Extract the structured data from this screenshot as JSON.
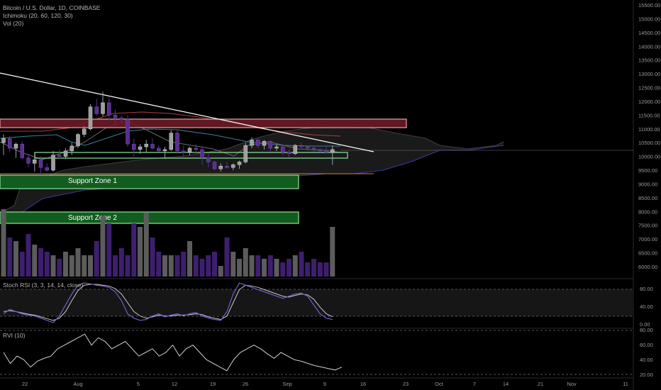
{
  "header": {
    "symbol": "Bitcoin / U.S. Dollar, 1D, COINBASE",
    "ichimoku": "Ichimoku (20, 60, 120, 30)",
    "volume": "Vol (20)"
  },
  "colors": {
    "background": "#000000",
    "up_candle": "#9e9e9e",
    "down_candle": "#5b2d8f",
    "trendline": "#ffffff",
    "resistance_zone": "#b33c4a",
    "support_zone": "#135c1f",
    "support_border": "#8fe59a",
    "tenkan": "#b23a3a",
    "kijun": "#3a7f9a",
    "cloud": "#1a1a1a",
    "rsi_k": "#7b5bd1",
    "rsi_d": "#c8c8c8"
  },
  "annotations": {
    "support_zone_1": "Support Zone 1",
    "support_zone_2": "Support Zone 2"
  },
  "price_axis": [
    "15500.00",
    "15000.00",
    "14500.00",
    "14000.00",
    "13500.00",
    "13000.00",
    "12500.00",
    "12000.00",
    "11500.00",
    "11000.00",
    "10500.00",
    "10000.00",
    "9500.00",
    "9000.00",
    "8500.00",
    "8000.00",
    "7500.00",
    "7000.00",
    "6500.00",
    "6000.00"
  ],
  "time_axis": [
    "22",
    "Aug",
    "5",
    "12",
    "19",
    "26",
    "Sep",
    "9",
    "16",
    "23",
    "Oct",
    "7",
    "14",
    "21",
    "Nov",
    "11"
  ],
  "stoch_rsi": {
    "label": "Stoch RSI (3, 3, 14, 14, close)",
    "ticks": [
      "80.00",
      "40.00",
      "0.00"
    ]
  },
  "rvi": {
    "label": "RVI (10)",
    "ticks": [
      "80.00",
      "60.00",
      "40.00",
      "20.00"
    ]
  },
  "chart_data": {
    "type": "candlestick",
    "price_range": [
      5800,
      15600
    ],
    "candles": [
      {
        "o": 10500,
        "h": 10800,
        "l": 10050,
        "c": 10650
      },
      {
        "o": 10650,
        "h": 10750,
        "l": 10150,
        "c": 10300
      },
      {
        "o": 10300,
        "h": 10500,
        "l": 9950,
        "c": 10450
      },
      {
        "o": 10450,
        "h": 10550,
        "l": 9900,
        "c": 9950
      },
      {
        "o": 9950,
        "h": 10100,
        "l": 9600,
        "c": 9750
      },
      {
        "o": 9750,
        "h": 10000,
        "l": 9450,
        "c": 9880
      },
      {
        "o": 9880,
        "h": 10000,
        "l": 9350,
        "c": 9600
      },
      {
        "o": 9600,
        "h": 9750,
        "l": 9450,
        "c": 9500
      },
      {
        "o": 9500,
        "h": 10200,
        "l": 9450,
        "c": 10050
      },
      {
        "o": 10050,
        "h": 10250,
        "l": 9900,
        "c": 10000
      },
      {
        "o": 10000,
        "h": 10300,
        "l": 9900,
        "c": 10200
      },
      {
        "o": 10200,
        "h": 10500,
        "l": 10050,
        "c": 10380
      },
      {
        "o": 10380,
        "h": 10850,
        "l": 10300,
        "c": 10800
      },
      {
        "o": 10800,
        "h": 11100,
        "l": 10700,
        "c": 11000
      },
      {
        "o": 11000,
        "h": 11900,
        "l": 10950,
        "c": 11800
      },
      {
        "o": 11800,
        "h": 12100,
        "l": 11500,
        "c": 11550
      },
      {
        "o": 11550,
        "h": 12350,
        "l": 11450,
        "c": 11950
      },
      {
        "o": 11950,
        "h": 12150,
        "l": 11300,
        "c": 11500
      },
      {
        "o": 11500,
        "h": 11700,
        "l": 11200,
        "c": 11400
      },
      {
        "o": 11400,
        "h": 11500,
        "l": 11250,
        "c": 11350
      },
      {
        "o": 11350,
        "h": 11500,
        "l": 10350,
        "c": 10450
      },
      {
        "o": 10450,
        "h": 10650,
        "l": 10000,
        "c": 10250
      },
      {
        "o": 10250,
        "h": 10450,
        "l": 10100,
        "c": 10350
      },
      {
        "o": 10350,
        "h": 10600,
        "l": 10150,
        "c": 10450
      },
      {
        "o": 10450,
        "h": 10650,
        "l": 10250,
        "c": 10300
      },
      {
        "o": 10300,
        "h": 10400,
        "l": 10150,
        "c": 10200
      },
      {
        "o": 10200,
        "h": 10350,
        "l": 9950,
        "c": 10250
      },
      {
        "o": 10250,
        "h": 10950,
        "l": 10200,
        "c": 10850
      },
      {
        "o": 10850,
        "h": 10950,
        "l": 10100,
        "c": 10200
      },
      {
        "o": 10200,
        "h": 10400,
        "l": 10000,
        "c": 10150
      },
      {
        "o": 10150,
        "h": 10350,
        "l": 10050,
        "c": 10300
      },
      {
        "o": 10300,
        "h": 10450,
        "l": 10100,
        "c": 10250
      },
      {
        "o": 10250,
        "h": 10400,
        "l": 9700,
        "c": 9950
      },
      {
        "o": 9950,
        "h": 10100,
        "l": 9600,
        "c": 9800
      },
      {
        "o": 9800,
        "h": 9850,
        "l": 9500,
        "c": 9550
      },
      {
        "o": 9550,
        "h": 9750,
        "l": 9450,
        "c": 9650
      },
      {
        "o": 9650,
        "h": 9800,
        "l": 9550,
        "c": 9600
      },
      {
        "o": 9600,
        "h": 9750,
        "l": 9500,
        "c": 9700
      },
      {
        "o": 9700,
        "h": 9850,
        "l": 9550,
        "c": 9800
      },
      {
        "o": 9800,
        "h": 10500,
        "l": 9750,
        "c": 10400
      },
      {
        "o": 10400,
        "h": 10700,
        "l": 10300,
        "c": 10600
      },
      {
        "o": 10600,
        "h": 10650,
        "l": 10300,
        "c": 10400
      },
      {
        "o": 10400,
        "h": 10600,
        "l": 10250,
        "c": 10550
      },
      {
        "o": 10550,
        "h": 10600,
        "l": 10150,
        "c": 10300
      },
      {
        "o": 10300,
        "h": 10450,
        "l": 10200,
        "c": 10350
      },
      {
        "o": 10350,
        "h": 10400,
        "l": 10050,
        "c": 10150
      },
      {
        "o": 10150,
        "h": 10250,
        "l": 9950,
        "c": 10100
      },
      {
        "o": 10100,
        "h": 10450,
        "l": 10050,
        "c": 10400
      },
      {
        "o": 10400,
        "h": 10500,
        "l": 10300,
        "c": 10350
      },
      {
        "o": 10350,
        "h": 10400,
        "l": 10200,
        "c": 10300
      },
      {
        "o": 10300,
        "h": 10350,
        "l": 10150,
        "c": 10250
      },
      {
        "o": 10250,
        "h": 10300,
        "l": 10150,
        "c": 10200
      },
      {
        "o": 10200,
        "h": 10400,
        "l": 10100,
        "c": 10150
      },
      {
        "o": 10150,
        "h": 10400,
        "l": 9700,
        "c": 10250
      }
    ],
    "volume_relative": [
      0.95,
      0.55,
      0.5,
      0.35,
      0.6,
      0.45,
      0.4,
      0.35,
      0.3,
      0.25,
      0.35,
      0.3,
      0.4,
      0.3,
      0.3,
      0.5,
      0.85,
      0.75,
      0.3,
      0.4,
      0.3,
      0.75,
      0.7,
      0.9,
      0.55,
      0.35,
      0.3,
      0.3,
      0.3,
      0.35,
      0.5,
      0.3,
      0.25,
      0.3,
      0.35,
      0.15,
      0.55,
      0.35,
      0.25,
      0.4,
      0.3,
      0.3,
      0.25,
      0.3,
      0.25,
      0.2,
      0.25,
      0.3,
      0.35,
      0.2,
      0.25,
      0.2,
      0.2,
      0.7
    ],
    "stoch_rsi_k": [
      25,
      35,
      30,
      25,
      22,
      20,
      15,
      10,
      5,
      20,
      45,
      70,
      90,
      95,
      93,
      90,
      88,
      85,
      75,
      55,
      25,
      15,
      10,
      12,
      20,
      25,
      18,
      22,
      25,
      20,
      25,
      28,
      20,
      15,
      12,
      10,
      30,
      70,
      95,
      90,
      85,
      80,
      75,
      70,
      65,
      60,
      65,
      70,
      72,
      65,
      45,
      25,
      15,
      12
    ],
    "stoch_rsi_d": [
      30,
      32,
      30,
      27,
      24,
      22,
      18,
      14,
      10,
      15,
      30,
      55,
      78,
      90,
      92,
      92,
      90,
      88,
      82,
      70,
      50,
      30,
      20,
      15,
      18,
      22,
      20,
      20,
      22,
      22,
      23,
      25,
      23,
      18,
      15,
      12,
      20,
      50,
      80,
      90,
      88,
      85,
      80,
      75,
      70,
      65,
      63,
      67,
      70,
      68,
      58,
      40,
      25,
      18
    ],
    "rvi": [
      50,
      35,
      45,
      40,
      30,
      38,
      42,
      45,
      55,
      60,
      65,
      70,
      75,
      60,
      70,
      65,
      55,
      60,
      65,
      55,
      45,
      50,
      55,
      45,
      50,
      60,
      45,
      55,
      60,
      50,
      40,
      35,
      30,
      25,
      40,
      50,
      55,
      60,
      55,
      48,
      42,
      50,
      45,
      40,
      38,
      35,
      32,
      30,
      28,
      26,
      30
    ]
  }
}
